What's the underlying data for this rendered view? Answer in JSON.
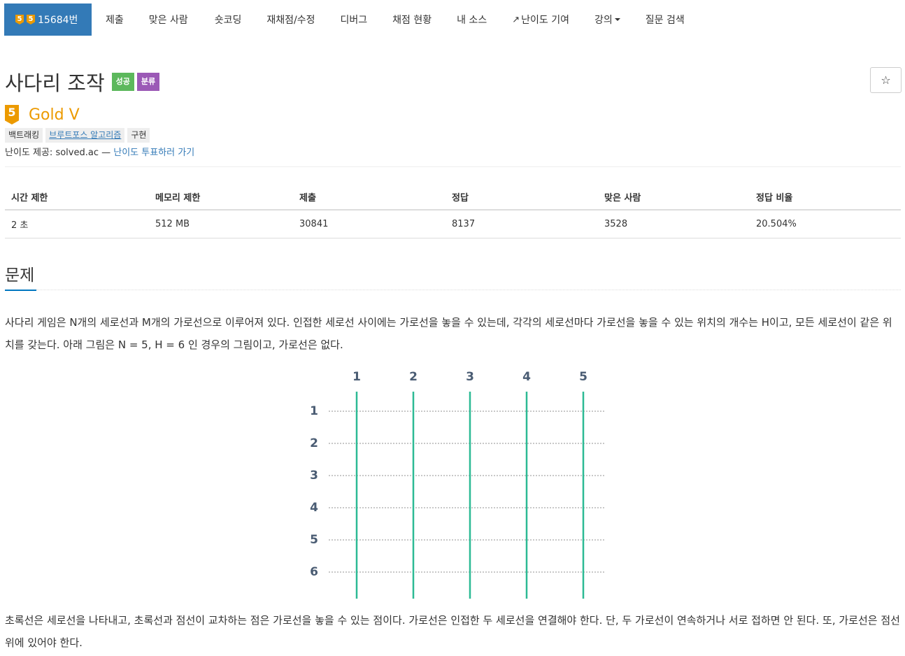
{
  "nav": {
    "problem_tier_badges": [
      "5",
      "5"
    ],
    "problem_id": "15684번",
    "items": [
      "제출",
      "맞은 사람",
      "숏코딩",
      "재채점/수정",
      "디버그",
      "채점 현황",
      "내 소스",
      "난이도 기여",
      "강의",
      "질문 검색"
    ]
  },
  "problem": {
    "title": "사다리 조작",
    "labels": [
      "성공",
      "분류"
    ],
    "star": "☆",
    "tier_number": "5",
    "tier_name": "Gold V",
    "tags": [
      "백트래킹",
      "브루트포스 알고리즘",
      "구현"
    ],
    "difficulty_prefix": "난이도 제공: solved.ac — ",
    "difficulty_link": "난이도 투표하러 가기"
  },
  "info_table": {
    "headers": [
      "시간 제한",
      "메모리 제한",
      "제출",
      "정답",
      "맞은 사람",
      "정답 비율"
    ],
    "values": [
      "2 초",
      "512 MB",
      "30841",
      "8137",
      "3528",
      "20.504%"
    ]
  },
  "section": {
    "title": "문제",
    "paragraph1": "사다리 게임은 N개의 세로선과 M개의 가로선으로 이루어져 있다. 인접한 세로선 사이에는 가로선을 놓을 수 있는데, 각각의 세로선마다 가로선을 놓을 수 있는 위치의 개수는 H이고, 모든 세로선이 같은 위치를 갖는다. 아래 그림은 N = 5, H = 6 인 경우의 그림이고, 가로선은 없다.",
    "paragraph2": "초록선은 세로선을 나타내고, 초록선과 점선이 교차하는 점은 가로선을 놓을 수 있는 점이다. 가로선은 인접한 두 세로선을 연결해야 한다. 단, 두 가로선이 연속하거나 서로 접하면 안 된다. 또, 가로선은 점선 위에 있어야 한다."
  },
  "figure": {
    "column_labels": [
      "1",
      "2",
      "3",
      "4",
      "5"
    ],
    "row_labels": [
      "1",
      "2",
      "3",
      "4",
      "5",
      "6"
    ]
  },
  "colors": {
    "nav_active": "#337ab7",
    "tier_gold": "#ec9a00",
    "success": "#5cb85c",
    "purple": "#9b59b6",
    "ladder_green": "#2cba94",
    "label_slate": "#4a5c73"
  }
}
